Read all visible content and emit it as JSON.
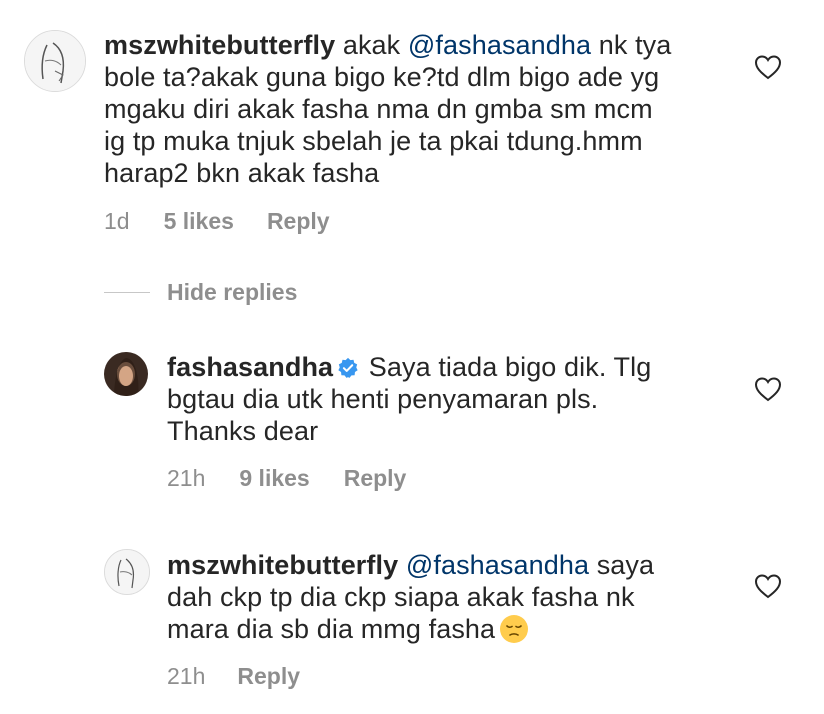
{
  "comments": [
    {
      "username": "mszwhitebutterfly",
      "mention": "@fashasandha",
      "lines": [
        "nk tya",
        "bole ta?akak guna bigo ke?td dlm bigo ade yg",
        "mgaku diri akak fasha nma dn gmba sm mcm",
        "ig tp muka tnjuk sbelah je ta pkai tdung.hmm",
        "harap2 bkn akak fasha"
      ],
      "prefix": "akak",
      "time": "1d",
      "likes": "5 likes",
      "reply": "Reply"
    },
    {
      "username": "fashasandha",
      "lines": [
        "Saya tiada bigo dik. Tlg",
        "bgtau dia utk henti penyamaran pls.",
        "Thanks dear"
      ],
      "time": "21h",
      "likes": "9 likes",
      "reply": "Reply"
    },
    {
      "username": "mszwhitebutterfly",
      "mention": "@fashasandha",
      "lines": [
        "saya",
        "dah ckp tp dia ckp siapa akak fasha nk",
        "mara dia sb dia mmg fasha"
      ],
      "time": "21h",
      "reply": "Reply"
    }
  ],
  "hide_replies": "Hide replies",
  "icons": {
    "like": "heart-outline-icon",
    "verified": "verified-badge-icon",
    "emoji": "pensive-face-emoji"
  },
  "colors": {
    "text": "#262626",
    "mention": "#003569",
    "secondary": "#8e8e8e",
    "verified": "#3897f0"
  }
}
